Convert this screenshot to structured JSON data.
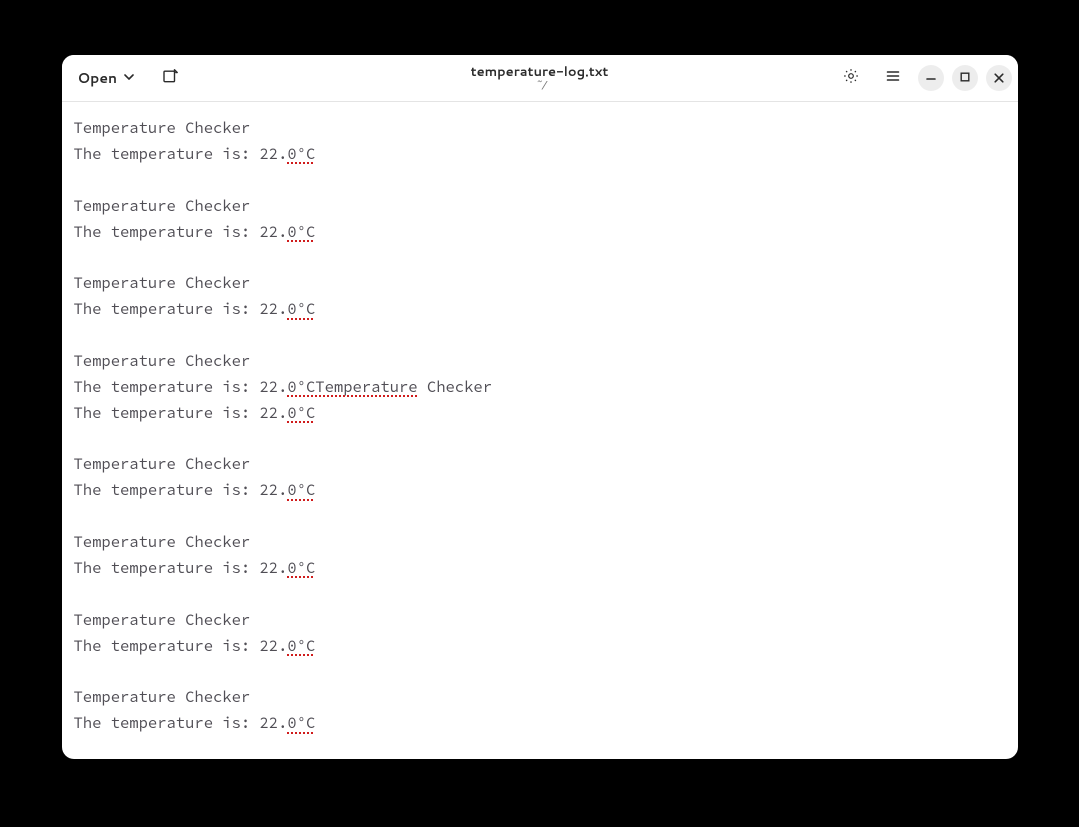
{
  "header": {
    "open_label": "Open",
    "title": "temperature-log.txt",
    "subtitle": "~/"
  },
  "lines": [
    {
      "type": "plain",
      "text": "Temperature Checker"
    },
    {
      "type": "reading",
      "prefix": "The temperature is: 22.",
      "marked": "0°C"
    },
    {
      "type": "blank"
    },
    {
      "type": "plain",
      "text": "Temperature Checker"
    },
    {
      "type": "reading",
      "prefix": "The temperature is: 22.",
      "marked": "0°C"
    },
    {
      "type": "blank"
    },
    {
      "type": "plain",
      "text": "Temperature Checker"
    },
    {
      "type": "reading",
      "prefix": "The temperature is: 22.",
      "marked": "0°C"
    },
    {
      "type": "blank"
    },
    {
      "type": "plain",
      "text": "Temperature Checker"
    },
    {
      "type": "joined",
      "prefix": "The temperature is: 22.",
      "marked": "0°CTemperature",
      "suffix": " Checker"
    },
    {
      "type": "reading",
      "prefix": "The temperature is: 22.",
      "marked": "0°C"
    },
    {
      "type": "blank"
    },
    {
      "type": "plain",
      "text": "Temperature Checker"
    },
    {
      "type": "reading",
      "prefix": "The temperature is: 22.",
      "marked": "0°C"
    },
    {
      "type": "blank"
    },
    {
      "type": "plain",
      "text": "Temperature Checker"
    },
    {
      "type": "reading",
      "prefix": "The temperature is: 22.",
      "marked": "0°C"
    },
    {
      "type": "blank"
    },
    {
      "type": "plain",
      "text": "Temperature Checker"
    },
    {
      "type": "reading",
      "prefix": "The temperature is: 22.",
      "marked": "0°C"
    },
    {
      "type": "blank"
    },
    {
      "type": "plain",
      "text": "Temperature Checker"
    },
    {
      "type": "reading",
      "prefix": "The temperature is: 22.",
      "marked": "0°C"
    }
  ]
}
